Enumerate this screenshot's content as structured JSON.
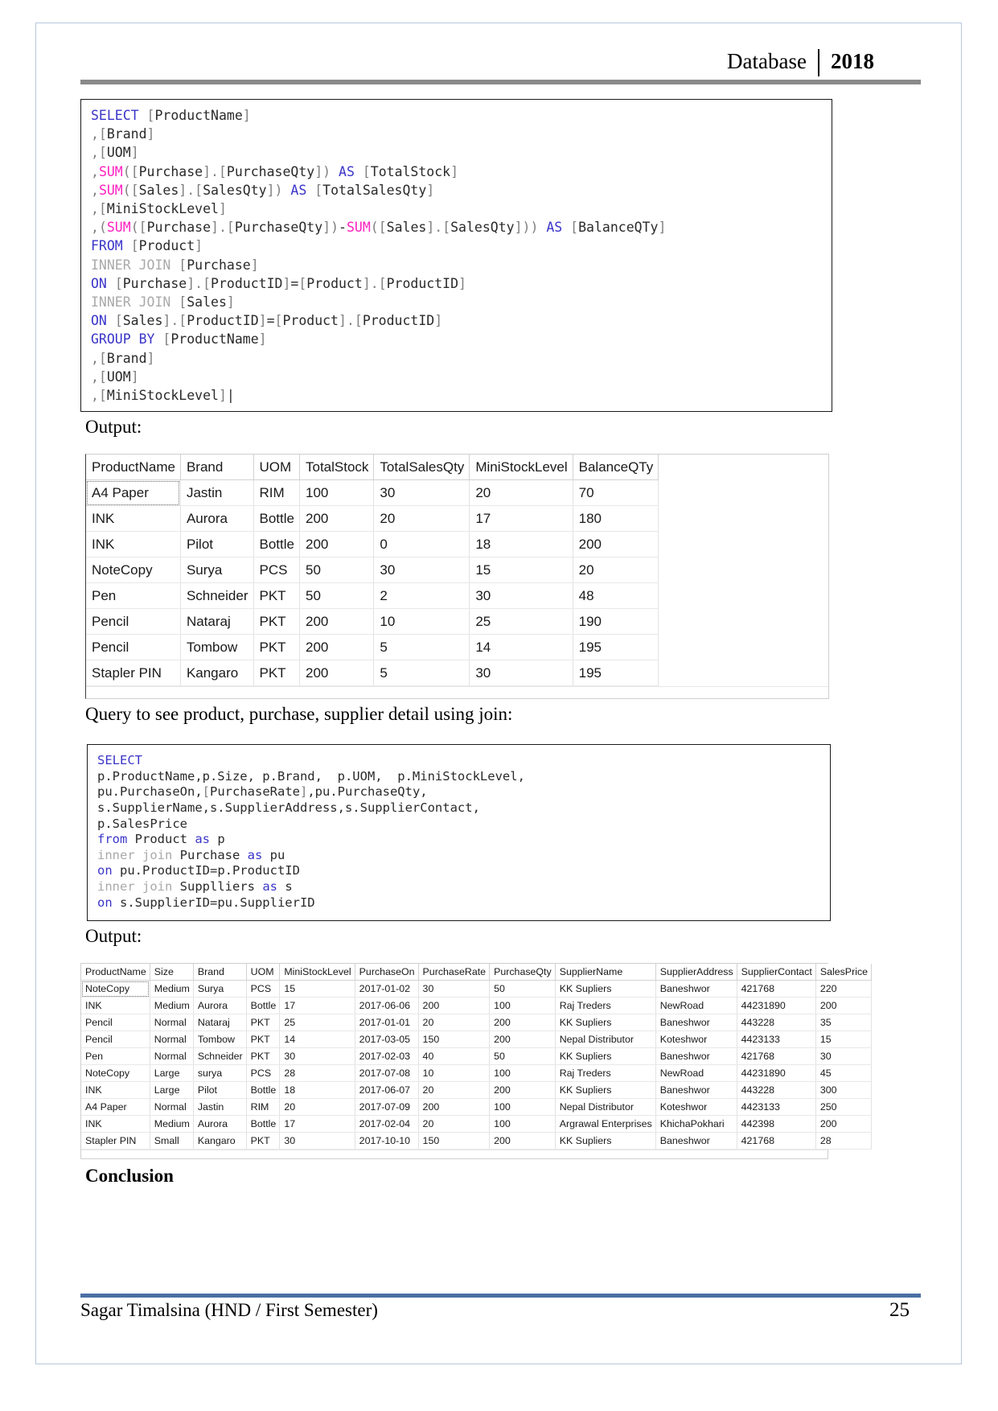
{
  "header": {
    "title": "Database",
    "year": "2018"
  },
  "query1": {
    "lines": [
      [
        {
          "t": "SELECT",
          "c": "kw"
        },
        {
          "t": " ",
          "c": "plain"
        },
        {
          "t": "[",
          "c": "brk"
        },
        {
          "t": "ProductName",
          "c": "plain"
        },
        {
          "t": "]",
          "c": "brk"
        }
      ],
      [
        {
          "t": ",",
          "c": "brk"
        },
        {
          "t": "[",
          "c": "brk"
        },
        {
          "t": "Brand",
          "c": "plain"
        },
        {
          "t": "]",
          "c": "brk"
        }
      ],
      [
        {
          "t": ",",
          "c": "brk"
        },
        {
          "t": "[",
          "c": "brk"
        },
        {
          "t": "UOM",
          "c": "plain"
        },
        {
          "t": "]",
          "c": "brk"
        }
      ],
      [
        {
          "t": ",",
          "c": "brk"
        },
        {
          "t": "SUM",
          "c": "fn"
        },
        {
          "t": "(",
          "c": "brk"
        },
        {
          "t": "[",
          "c": "brk"
        },
        {
          "t": "Purchase",
          "c": "plain"
        },
        {
          "t": "]",
          "c": "brk"
        },
        {
          "t": ".",
          "c": "brk"
        },
        {
          "t": "[",
          "c": "brk"
        },
        {
          "t": "PurchaseQty",
          "c": "plain"
        },
        {
          "t": "]",
          "c": "brk"
        },
        {
          "t": ")",
          "c": "brk"
        },
        {
          "t": " ",
          "c": "plain"
        },
        {
          "t": "AS",
          "c": "kw"
        },
        {
          "t": " ",
          "c": "plain"
        },
        {
          "t": "[",
          "c": "brk"
        },
        {
          "t": "TotalStock",
          "c": "plain"
        },
        {
          "t": "]",
          "c": "brk"
        }
      ],
      [
        {
          "t": ",",
          "c": "brk"
        },
        {
          "t": "SUM",
          "c": "fn"
        },
        {
          "t": "(",
          "c": "brk"
        },
        {
          "t": "[",
          "c": "brk"
        },
        {
          "t": "Sales",
          "c": "plain"
        },
        {
          "t": "]",
          "c": "brk"
        },
        {
          "t": ".",
          "c": "brk"
        },
        {
          "t": "[",
          "c": "brk"
        },
        {
          "t": "SalesQty",
          "c": "plain"
        },
        {
          "t": "]",
          "c": "brk"
        },
        {
          "t": ")",
          "c": "brk"
        },
        {
          "t": " ",
          "c": "plain"
        },
        {
          "t": "AS",
          "c": "kw"
        },
        {
          "t": " ",
          "c": "plain"
        },
        {
          "t": "[",
          "c": "brk"
        },
        {
          "t": "TotalSalesQty",
          "c": "plain"
        },
        {
          "t": "]",
          "c": "brk"
        }
      ],
      [
        {
          "t": ",",
          "c": "brk"
        },
        {
          "t": "[",
          "c": "brk"
        },
        {
          "t": "MiniStockLevel",
          "c": "plain"
        },
        {
          "t": "]",
          "c": "brk"
        }
      ],
      [
        {
          "t": ",",
          "c": "brk"
        },
        {
          "t": "(",
          "c": "brk"
        },
        {
          "t": "SUM",
          "c": "fn"
        },
        {
          "t": "(",
          "c": "brk"
        },
        {
          "t": "[",
          "c": "brk"
        },
        {
          "t": "Purchase",
          "c": "plain"
        },
        {
          "t": "]",
          "c": "brk"
        },
        {
          "t": ".",
          "c": "brk"
        },
        {
          "t": "[",
          "c": "brk"
        },
        {
          "t": "PurchaseQty",
          "c": "plain"
        },
        {
          "t": "]",
          "c": "brk"
        },
        {
          "t": ")",
          "c": "brk"
        },
        {
          "t": "-",
          "c": "plain"
        },
        {
          "t": "SUM",
          "c": "fn"
        },
        {
          "t": "(",
          "c": "brk"
        },
        {
          "t": "[",
          "c": "brk"
        },
        {
          "t": "Sales",
          "c": "plain"
        },
        {
          "t": "]",
          "c": "brk"
        },
        {
          "t": ".",
          "c": "brk"
        },
        {
          "t": "[",
          "c": "brk"
        },
        {
          "t": "SalesQty",
          "c": "plain"
        },
        {
          "t": "]",
          "c": "brk"
        },
        {
          "t": "))",
          "c": "brk"
        },
        {
          "t": " ",
          "c": "plain"
        },
        {
          "t": "AS",
          "c": "kw"
        },
        {
          "t": " ",
          "c": "plain"
        },
        {
          "t": "[",
          "c": "brk"
        },
        {
          "t": "BalanceQTy",
          "c": "plain"
        },
        {
          "t": "]",
          "c": "brk"
        }
      ],
      [
        {
          "t": "FROM",
          "c": "kw"
        },
        {
          "t": " ",
          "c": "plain"
        },
        {
          "t": "[",
          "c": "brk"
        },
        {
          "t": "Product",
          "c": "plain"
        },
        {
          "t": "]",
          "c": "brk"
        }
      ],
      [
        {
          "t": "INNER JOIN",
          "c": "kw-dim"
        },
        {
          "t": " ",
          "c": "plain"
        },
        {
          "t": "[",
          "c": "brk"
        },
        {
          "t": "Purchase",
          "c": "plain"
        },
        {
          "t": "]",
          "c": "brk"
        }
      ],
      [
        {
          "t": "ON",
          "c": "kw"
        },
        {
          "t": " ",
          "c": "plain"
        },
        {
          "t": "[",
          "c": "brk"
        },
        {
          "t": "Purchase",
          "c": "plain"
        },
        {
          "t": "]",
          "c": "brk"
        },
        {
          "t": ".",
          "c": "brk"
        },
        {
          "t": "[",
          "c": "brk"
        },
        {
          "t": "ProductID",
          "c": "plain"
        },
        {
          "t": "]",
          "c": "brk"
        },
        {
          "t": "=",
          "c": "plain"
        },
        {
          "t": "[",
          "c": "brk"
        },
        {
          "t": "Product",
          "c": "plain"
        },
        {
          "t": "]",
          "c": "brk"
        },
        {
          "t": ".",
          "c": "brk"
        },
        {
          "t": "[",
          "c": "brk"
        },
        {
          "t": "ProductID",
          "c": "plain"
        },
        {
          "t": "]",
          "c": "brk"
        }
      ],
      [
        {
          "t": "INNER JOIN",
          "c": "kw-dim"
        },
        {
          "t": " ",
          "c": "plain"
        },
        {
          "t": "[",
          "c": "brk"
        },
        {
          "t": "Sales",
          "c": "plain"
        },
        {
          "t": "]",
          "c": "brk"
        }
      ],
      [
        {
          "t": "ON",
          "c": "kw"
        },
        {
          "t": " ",
          "c": "plain"
        },
        {
          "t": "[",
          "c": "brk"
        },
        {
          "t": "Sales",
          "c": "plain"
        },
        {
          "t": "]",
          "c": "brk"
        },
        {
          "t": ".",
          "c": "brk"
        },
        {
          "t": "[",
          "c": "brk"
        },
        {
          "t": "ProductID",
          "c": "plain"
        },
        {
          "t": "]",
          "c": "brk"
        },
        {
          "t": "=",
          "c": "plain"
        },
        {
          "t": "[",
          "c": "brk"
        },
        {
          "t": "Product",
          "c": "plain"
        },
        {
          "t": "]",
          "c": "brk"
        },
        {
          "t": ".",
          "c": "brk"
        },
        {
          "t": "[",
          "c": "brk"
        },
        {
          "t": "ProductID",
          "c": "plain"
        },
        {
          "t": "]",
          "c": "brk"
        }
      ],
      [
        {
          "t": "GROUP BY",
          "c": "kw"
        },
        {
          "t": " ",
          "c": "plain"
        },
        {
          "t": "[",
          "c": "brk"
        },
        {
          "t": "ProductName",
          "c": "plain"
        },
        {
          "t": "]",
          "c": "brk"
        }
      ],
      [
        {
          "t": ",",
          "c": "brk"
        },
        {
          "t": "[",
          "c": "brk"
        },
        {
          "t": "Brand",
          "c": "plain"
        },
        {
          "t": "]",
          "c": "brk"
        }
      ],
      [
        {
          "t": ",",
          "c": "brk"
        },
        {
          "t": "[",
          "c": "brk"
        },
        {
          "t": "UOM",
          "c": "plain"
        },
        {
          "t": "]",
          "c": "brk"
        }
      ],
      [
        {
          "t": ",",
          "c": "brk"
        },
        {
          "t": "[",
          "c": "brk"
        },
        {
          "t": "MiniStockLevel",
          "c": "plain"
        },
        {
          "t": "]",
          "c": "brk"
        },
        {
          "t": "|",
          "c": "plain"
        }
      ]
    ]
  },
  "output_label_1": "Output:",
  "table1": {
    "columns": [
      "ProductName",
      "Brand",
      "UOM",
      "TotalStock",
      "TotalSalesQty",
      "MiniStockLevel",
      "BalanceQTy"
    ],
    "rows": [
      [
        "A4 Paper",
        "Jastin",
        "RIM",
        "100",
        "30",
        "20",
        "70"
      ],
      [
        "INK",
        "Aurora",
        "Bottle",
        "200",
        "20",
        "17",
        "180"
      ],
      [
        "INK",
        "Pilot",
        "Bottle",
        "200",
        "0",
        "18",
        "200"
      ],
      [
        "NoteCopy",
        "Surya",
        "PCS",
        "50",
        "30",
        "15",
        "20"
      ],
      [
        "Pen",
        "Schneider",
        "PKT",
        "50",
        "2",
        "30",
        "48"
      ],
      [
        "Pencil",
        "Nataraj",
        "PKT",
        "200",
        "10",
        "25",
        "190"
      ],
      [
        "Pencil",
        "Tombow",
        "PKT",
        "200",
        "5",
        "14",
        "195"
      ],
      [
        "Stapler PIN",
        "Kangaro",
        "PKT",
        "200",
        "5",
        "30",
        "195"
      ]
    ],
    "selected_cell": {
      "row": 0,
      "col": 0
    }
  },
  "caption2": "Query to see product, purchase, supplier detail using join:",
  "query2": {
    "lines": [
      [
        {
          "t": "SELECT",
          "c": "kw"
        }
      ],
      [
        {
          "t": "p.ProductName,p.Size, p.Brand,  p.UOM,  p.MiniStockLevel,",
          "c": "plain"
        }
      ],
      [
        {
          "t": "pu.PurchaseOn,",
          "c": "plain"
        },
        {
          "t": "[",
          "c": "brk"
        },
        {
          "t": "PurchaseRate",
          "c": "plain"
        },
        {
          "t": "]",
          "c": "brk"
        },
        {
          "t": ",pu.PurchaseQty,",
          "c": "plain"
        }
      ],
      [
        {
          "t": "s.SupplierName,s.SupplierAddress,s.SupplierContact,",
          "c": "plain"
        }
      ],
      [
        {
          "t": "p.SalesPrice",
          "c": "plain"
        }
      ],
      [
        {
          "t": "from",
          "c": "kw"
        },
        {
          "t": " Product ",
          "c": "plain"
        },
        {
          "t": "as",
          "c": "kw"
        },
        {
          "t": " p",
          "c": "plain"
        }
      ],
      [
        {
          "t": "inner join",
          "c": "kw-dim"
        },
        {
          "t": " Purchase ",
          "c": "plain"
        },
        {
          "t": "as",
          "c": "kw"
        },
        {
          "t": " pu",
          "c": "plain"
        }
      ],
      [
        {
          "t": "on",
          "c": "kw"
        },
        {
          "t": " pu.ProductID=p.ProductID",
          "c": "plain"
        }
      ],
      [
        {
          "t": "inner join",
          "c": "kw-dim"
        },
        {
          "t": " Supplliers ",
          "c": "plain"
        },
        {
          "t": "as",
          "c": "kw"
        },
        {
          "t": " s",
          "c": "plain"
        }
      ],
      [
        {
          "t": "on",
          "c": "kw"
        },
        {
          "t": " s.SupplierID=pu.SupplierID",
          "c": "plain"
        }
      ]
    ]
  },
  "output_label_2": "Output:",
  "table2": {
    "columns": [
      "ProductName",
      "Size",
      "Brand",
      "UOM",
      "MiniStockLevel",
      "PurchaseOn",
      "PurchaseRate",
      "PurchaseQty",
      "SupplierName",
      "SupplierAddress",
      "SupplierContact",
      "SalesPrice"
    ],
    "rows": [
      [
        "NoteCopy",
        "Medium",
        "Surya",
        "PCS",
        "15",
        "2017-01-02",
        "30",
        "50",
        "KK Supliers",
        "Baneshwor",
        "421768",
        "220"
      ],
      [
        "INK",
        "Medium",
        "Aurora",
        "Bottle",
        "17",
        "2017-06-06",
        "200",
        "100",
        "Raj Treders",
        "NewRoad",
        "44231890",
        "200"
      ],
      [
        "Pencil",
        "Normal",
        "Nataraj",
        "PKT",
        "25",
        "2017-01-01",
        "20",
        "200",
        "KK Supliers",
        "Baneshwor",
        "443228",
        "35"
      ],
      [
        "Pencil",
        "Normal",
        "Tombow",
        "PKT",
        "14",
        "2017-03-05",
        "150",
        "200",
        "Nepal Distributor",
        "Koteshwor",
        "4423133",
        "15"
      ],
      [
        "Pen",
        "Normal",
        "Schneider",
        "PKT",
        "30",
        "2017-02-03",
        "40",
        "50",
        "KK Supliers",
        "Baneshwor",
        "421768",
        "30"
      ],
      [
        "NoteCopy",
        "Large",
        "surya",
        "PCS",
        "28",
        "2017-07-08",
        "10",
        "100",
        "Raj Treders",
        "NewRoad",
        "44231890",
        "45"
      ],
      [
        "INK",
        "Large",
        "Pilot",
        "Bottle",
        "18",
        "2017-06-07",
        "20",
        "200",
        "KK Supliers",
        "Baneshwor",
        "443228",
        "300"
      ],
      [
        "A4 Paper",
        "Normal",
        "Jastin",
        "RIM",
        "20",
        "2017-07-09",
        "200",
        "100",
        "Nepal Distributor",
        "Koteshwor",
        "4423133",
        "250"
      ],
      [
        "INK",
        "Medium",
        "Aurora",
        "Bottle",
        "17",
        "2017-02-04",
        "20",
        "100",
        "Argrawal Enterprises",
        "KhichaPokhari",
        "442398",
        "200"
      ],
      [
        "Stapler PIN",
        "Small",
        "Kangaro",
        "PKT",
        "30",
        "2017-10-10",
        "150",
        "200",
        "KK Supliers",
        "Baneshwor",
        "421768",
        "28"
      ]
    ],
    "selected_cell": {
      "row": 0,
      "col": 0
    }
  },
  "conclusion_heading": "Conclusion",
  "footer": {
    "author": "Sagar Timalsina (HND / First Semester)",
    "page_number": "25"
  },
  "colors": {
    "keyword": "#3a35c8",
    "keyword_dim": "#a9a9a9",
    "function": "#ff20c0",
    "bracket": "#808080",
    "header_rule": "#8a8a8a",
    "footer_rule": "#4a6fa5",
    "page_border": "#b9c6dd"
  }
}
